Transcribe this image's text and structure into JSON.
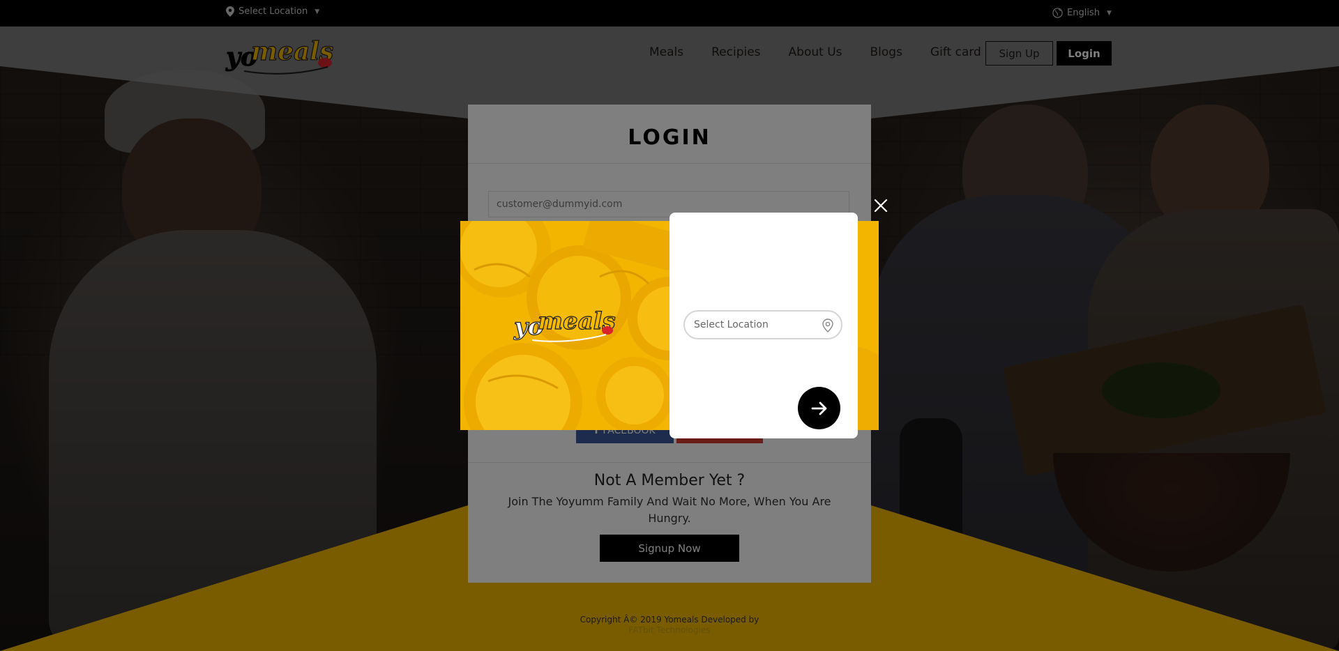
{
  "topbar": {
    "location_label": "Select Location",
    "language_label": "English"
  },
  "nav": {
    "logo_text_yo": "yo",
    "logo_text_meals": "meals",
    "links": [
      "Meals",
      "Recipies",
      "About Us",
      "Blogs",
      "Gift card"
    ],
    "signup_label": "Sign Up",
    "login_label": "Login"
  },
  "login": {
    "title": "LOGIN",
    "email_value": "customer@dummyid.com",
    "facebook_label": "FACEBOOK",
    "member_title": "Not A Member Yet ?",
    "member_text": "Join The Yoyumm Family And Wait No More, When You Are Hungry.",
    "signup_now_label": "Signup Now"
  },
  "footer": {
    "copyright": "Copyright Â© 2019 Yomeals Developed by",
    "company": "FATbit Technologies"
  },
  "modal": {
    "logo_text_yo": "yo",
    "logo_text_meals": "meals",
    "location_placeholder": "Select Location",
    "icons": [
      "close-icon",
      "location-pin-icon",
      "arrow-right-icon"
    ]
  },
  "colors": {
    "brand_yellow": "#F5B800",
    "black": "#000000",
    "white": "#FFFFFF",
    "facebook_blue": "#3B5998"
  }
}
